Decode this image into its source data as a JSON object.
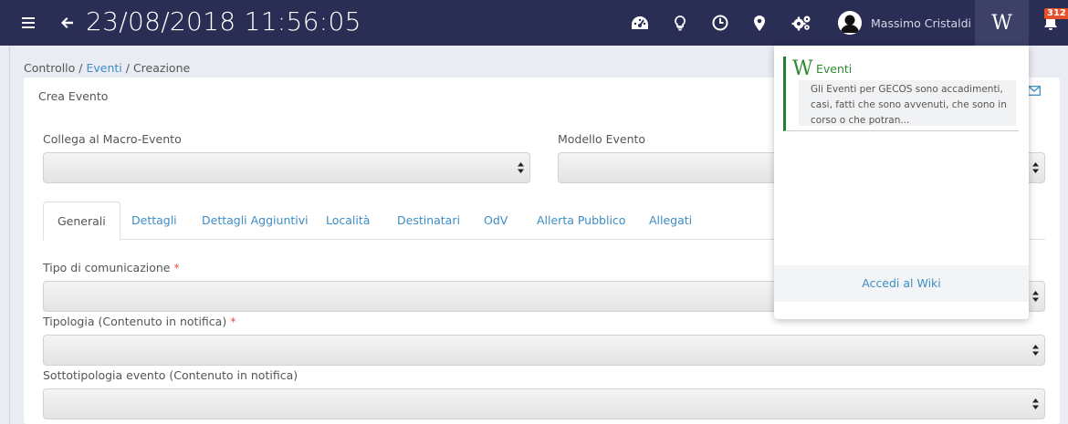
{
  "header": {
    "datetime": "23/08/2018 11:56:05",
    "user_name": "Massimo Cristaldi",
    "wiki_symbol": "W",
    "notifications_count": "312",
    "icons": [
      "menu-icon",
      "back-arrow-icon",
      "dashboard-icon",
      "lightbulb-icon",
      "clock-icon",
      "map-marker-icon",
      "cogs-icon",
      "user-avatar-icon",
      "wikipedia-icon",
      "bell-icon"
    ]
  },
  "breadcrumb": {
    "root": "Controllo",
    "sep1": " / ",
    "link": "Eventi",
    "sep2": " / ",
    "current": "Creazione"
  },
  "panel": {
    "title": "Crea Evento"
  },
  "form": {
    "macro_event_label": "Collega al Macro-Evento",
    "macro_event_value": "",
    "model_label": "Modello Evento",
    "model_value": "",
    "comm_type_label": "Tipo di comunicazione",
    "typology_label": "Tipologia (Contenuto in notifica)",
    "subtypology_label": "Sottotipologia evento (Contenuto in notifica)",
    "required_mark": "*"
  },
  "tabs": [
    {
      "label": "Generali",
      "active": true
    },
    {
      "label": "Dettagli"
    },
    {
      "label": "Dettagli Aggiuntivi"
    },
    {
      "label": "Località"
    },
    {
      "label": "Destinatari"
    },
    {
      "label": "OdV"
    },
    {
      "label": "Allerta Pubblico"
    },
    {
      "label": "Allegati"
    }
  ],
  "wiki_dropdown": {
    "item_logo": "W",
    "item_title": "Eventi",
    "item_desc": "Gli Eventi per GECOS sono accadimenti, casi, fatti che sono avvenuti, che sono in corso o che potran...",
    "footer_link": "Accedi al Wiki"
  },
  "colors": {
    "navbar": "#2a2d54",
    "accent_link": "#3c8dc4",
    "wiki_green": "#2e8b2e",
    "badge": "#e4512b",
    "required": "#d9534f"
  }
}
